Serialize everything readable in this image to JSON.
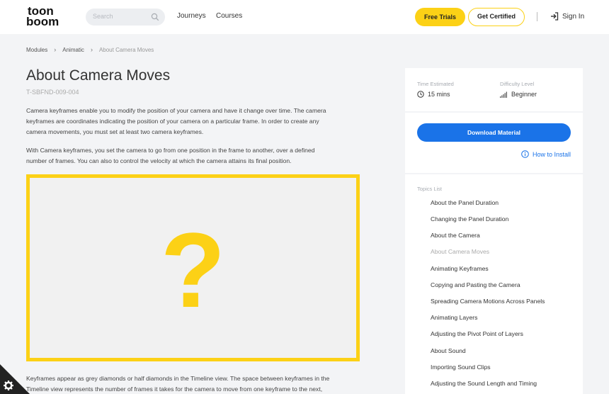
{
  "header": {
    "logo_top": "toon",
    "logo_bottom": "boom",
    "search_placeholder": "Search",
    "nav": [
      "Journeys",
      "Courses"
    ],
    "free_trials": "Free Trials",
    "get_certified": "Get Certified",
    "sign_in": "Sign In",
    "accent": "#fcd116"
  },
  "breadcrumb": [
    "Modules",
    "Animatic",
    "About Camera Moves"
  ],
  "main": {
    "title": "About Camera Moves",
    "code": "T-SBFND-009-004",
    "paragraphs": [
      [
        "Camera keyframes enable you to modify the position of your camera and have it change over time. The camera",
        "keyframes are coordinates indicating the position of your camera on a particular frame. In order to create any",
        "camera movements, you must set at least two camera keyframes."
      ],
      [
        "With Camera keyframes, you set the camera to go from one position in the frame to another, over a defined",
        "number of frames. You can also to control the velocity at which the camera attains its final position."
      ],
      [
        "Keyframes appear as grey diamonds or half diamonds in the Timeline view. The space between keyframes in the",
        "Timeline view represents the number of frames it takes for the camera to move from one keyframe to the next,"
      ]
    ],
    "placeholder_glyph": "?"
  },
  "sidebar": {
    "time_label": "Time Estimated",
    "time_value": "15 mins",
    "difficulty_label": "Difficulty Level",
    "difficulty_value": "Beginner",
    "download": "Download Material",
    "how_to_install": "How to Install",
    "link_color": "#1a73e8",
    "topics_label": "Topics List",
    "topics": [
      "About the Panel Duration",
      "Changing the Panel Duration",
      "About the Camera",
      "About Camera Moves",
      "Animating Keyframes",
      "Copying and Pasting the Camera",
      "Spreading Camera Motions Across Panels",
      "Animating Layers",
      "Adjusting the Pivot Point of Layers",
      "About Sound",
      "Importing Sound Clips",
      "Adjusting the Sound Length and Timing"
    ],
    "active_topic_index": 3
  }
}
